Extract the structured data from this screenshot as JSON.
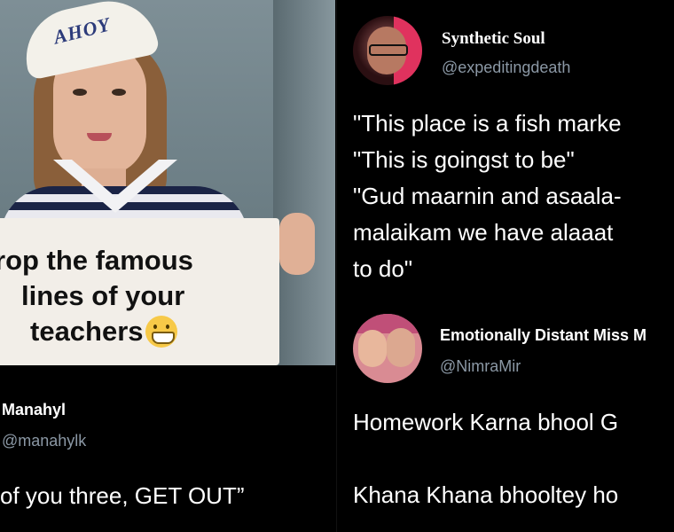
{
  "left_panel": {
    "meme": {
      "hat_text": "AHOY",
      "sign_lines": [
        "rop the famous",
        "lines of your",
        "teachers"
      ],
      "emoji": "grinning-face-with-smiling-eyes"
    },
    "tweet": {
      "display_name": "Manahyl",
      "handle": "@manahylk",
      "text": "of you three, GET OUT”"
    }
  },
  "right_panel": {
    "tweet1": {
      "display_name": "Synthetic Soul",
      "handle": "@expeditingdeath",
      "lines": [
        "\"This place is a fish marke",
        "\"This is goingst to be\"",
        "\"Gud maarnin and asaala-",
        "malaikam we have alaaat",
        "to do\""
      ]
    },
    "tweet2": {
      "display_name": "Emotionally Distant Miss M",
      "handle": "@NimraMir",
      "lines": [
        "Homework Karna bhool G",
        "Khana Khana bhooltey ho"
      ]
    }
  },
  "colors": {
    "background": "#000000",
    "text": "#ffffff",
    "handle": "#8b98a5"
  }
}
